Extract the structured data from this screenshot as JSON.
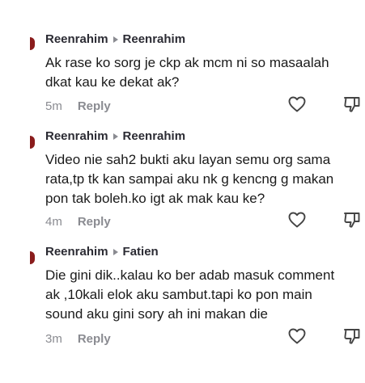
{
  "comments": [
    {
      "author": "Reenrahim",
      "reply_to": "Reenrahim",
      "lines": [
        "Ak rase ko sorg je ckp ak mcm ni so masaalah",
        "dkat kau ke dekat ak?"
      ],
      "time": "5m",
      "reply_label": "Reply",
      "avatar_color": "#8a1c1c"
    },
    {
      "author": "Reenrahim",
      "reply_to": "Reenrahim",
      "lines": [
        "Video nie sah2 bukti aku layan semu org sama",
        "rata,tp tk kan sampai aku nk g kencng g makan",
        "pon tak boleh.ko igt ak mak kau ke?"
      ],
      "time": "4m",
      "reply_label": "Reply",
      "avatar_color": "#8a1c1c"
    },
    {
      "author": "Reenrahim",
      "reply_to": "Fatien",
      "lines": [
        "Die gini dik..kalau ko ber adab masuk comment",
        "ak ,10kali elok aku sambut.tapi ko pon main",
        "sound aku gini sory ah ini makan die"
      ],
      "time": "3m",
      "reply_label": "Reply",
      "avatar_color": "#8a1c1c"
    }
  ],
  "icons": {
    "like": "heart-outline-icon",
    "dislike": "thumbs-down-outline-icon"
  },
  "colors": {
    "text": "#1a1a1a",
    "username": "#2b2b33",
    "muted": "#8a8b91",
    "icon_stroke": "#444444"
  }
}
